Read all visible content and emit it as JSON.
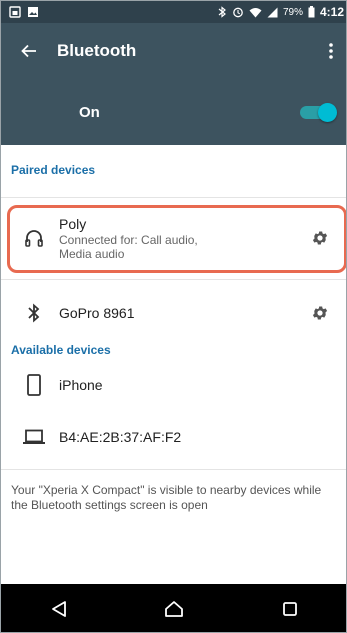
{
  "status_bar": {
    "battery_text": "79%",
    "time": "4:12"
  },
  "app_bar": {
    "title": "Bluetooth"
  },
  "toggle": {
    "label": "On",
    "enabled": true,
    "accent": "#00bcd4"
  },
  "paired": {
    "header": "Paired devices",
    "devices": [
      {
        "name": "Poly",
        "subtitle": "Connected for: Call audio, Media audio",
        "icon": "headphones-icon"
      },
      {
        "name": "GoPro 8961",
        "subtitle": "",
        "icon": "bluetooth-icon"
      }
    ]
  },
  "available": {
    "header": "Available devices",
    "devices": [
      {
        "name": "iPhone",
        "icon": "phone-icon"
      },
      {
        "name": "B4:AE:2B:37:AF:F2",
        "icon": "laptop-icon"
      }
    ]
  },
  "visibility_note": "Your \"Xperia X Compact\" is visible to nearby devices while the Bluetooth settings screen is open",
  "colors": {
    "header_bg": "#3d535f",
    "status_bg": "#2f414c",
    "section_header": "#1b6fa8",
    "highlight": "#e86a50"
  }
}
